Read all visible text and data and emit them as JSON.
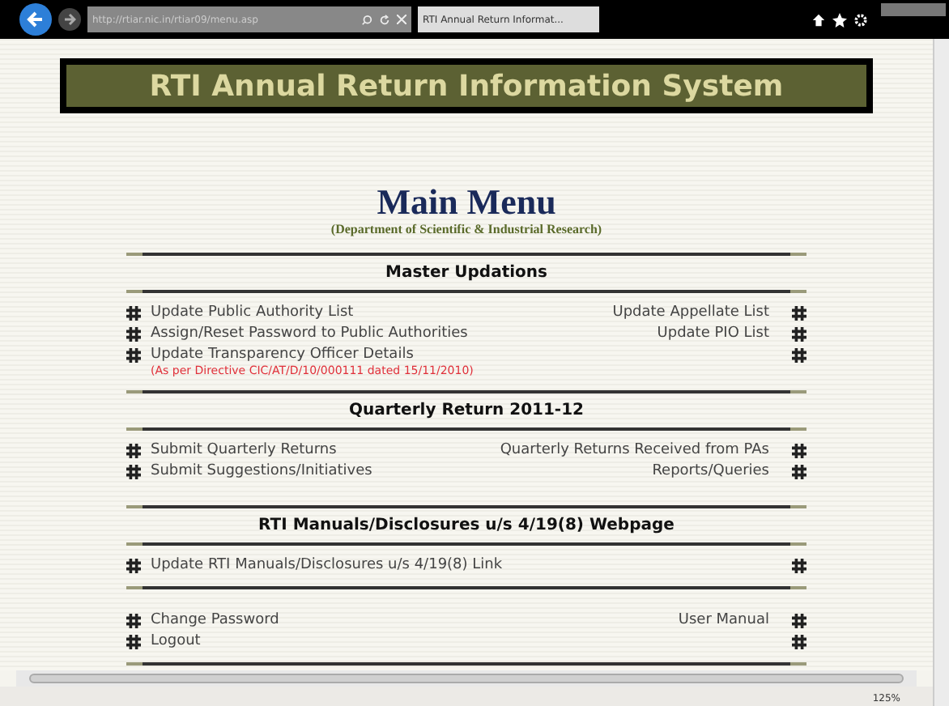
{
  "browser": {
    "address": "http://rtiar.nic.in/rtiar09/menu.asp",
    "tab": "RTI Annual Return Informat...",
    "zoom": "125%"
  },
  "banner": {
    "title": "RTI Annual Return Information System"
  },
  "heading": {
    "title": "Main Menu",
    "subtitle": "(Department of Scientific & Industrial Research)"
  },
  "sections": [
    {
      "title": "Master Updations",
      "rows": [
        {
          "left": "Update Public Authority List",
          "right": "Update Appellate List"
        },
        {
          "left": "Assign/Reset Password to Public Authorities",
          "right": "Update PIO List"
        },
        {
          "left": "Update Transparency Officer Details",
          "note": "(As per Directive CIC/AT/D/10/000111 dated 15/11/2010)"
        }
      ]
    },
    {
      "title": "Quarterly Return 2011-12",
      "rows": [
        {
          "left": "Submit Quarterly Returns",
          "right": "Quarterly Returns Received from PAs"
        },
        {
          "left": "Submit Suggestions/Initiatives",
          "right": "Reports/Queries"
        }
      ]
    },
    {
      "title": "RTI Manuals/Disclosures u/s 4/19(8) Webpage",
      "rows": [
        {
          "left": "Update RTI Manuals/Disclosures u/s 4/19(8) Link"
        }
      ]
    },
    {
      "rows": [
        {
          "left": "Change Password",
          "right": "User Manual"
        },
        {
          "left": "Logout"
        }
      ]
    }
  ]
}
